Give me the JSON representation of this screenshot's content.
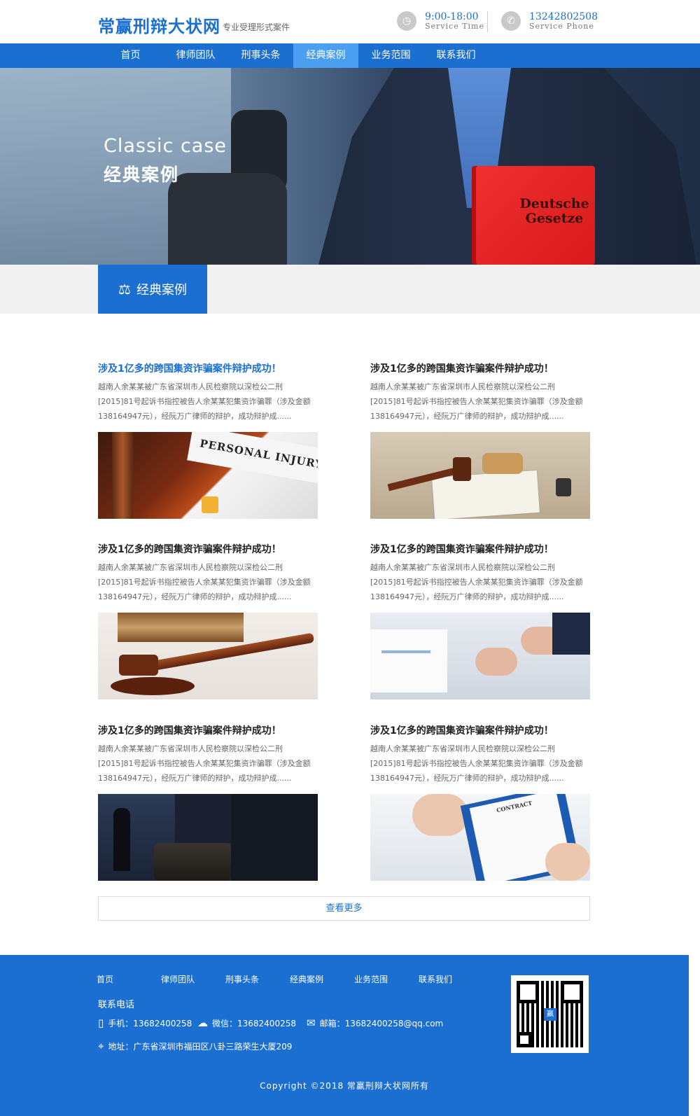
{
  "header": {
    "logo": "常赢刑辩大状网",
    "slogan": "专业受理形式案件",
    "time_value": "9:00-18:00",
    "time_label": "Service Time",
    "phone_value": "13242802508",
    "phone_label": "Service Phone"
  },
  "nav": {
    "items": [
      "首页",
      "律师团队",
      "刑事头条",
      "经典案例",
      "业务范围",
      "联系我们"
    ],
    "active_index": 3
  },
  "banner": {
    "title_en": "Classic case",
    "title_cn": "经典案例",
    "book_text": "Deutsche Gesetze"
  },
  "section": {
    "title": "经典案例"
  },
  "cases": [
    {
      "title": "涉及1亿多的跨国集资诈骗案件辩护成功！",
      "desc": "越南人余某某被广东省深圳市人民检察院以深检公二刑[2015]81号起诉书指控被告人余某某犯集资诈骗罪（涉及金额138164947元），经阮万广律师的辩护，成功辩护成......",
      "highlight": true,
      "image_text": "PERSONAL INJURY"
    },
    {
      "title": "涉及1亿多的跨国集资诈骗案件辩护成功！",
      "desc": "越南人余某某被广东省深圳市人民检察院以深检公二刑[2015]81号起诉书指控被告人余某某犯集资诈骗罪（涉及金额138164947元），经阮万广律师的辩护，成功辩护成......",
      "highlight": false
    },
    {
      "title": "涉及1亿多的跨国集资诈骗案件辩护成功！",
      "desc": "越南人余某某被广东省深圳市人民检察院以深检公二刑[2015]81号起诉书指控被告人余某某犯集资诈骗罪（涉及金额138164947元），经阮万广律师的辩护，成功辩护成......",
      "highlight": false
    },
    {
      "title": "涉及1亿多的跨国集资诈骗案件辩护成功！",
      "desc": "越南人余某某被广东省深圳市人民检察院以深检公二刑[2015]81号起诉书指控被告人余某某犯集资诈骗罪（涉及金额138164947元），经阮万广律师的辩护，成功辩护成......",
      "highlight": false
    },
    {
      "title": "涉及1亿多的跨国集资诈骗案件辩护成功！",
      "desc": "越南人余某某被广东省深圳市人民检察院以深检公二刑[2015]81号起诉书指控被告人余某某犯集资诈骗罪（涉及金额138164947元），经阮万广律师的辩护，成功辩护成......",
      "highlight": false
    },
    {
      "title": "涉及1亿多的跨国集资诈骗案件辩护成功！",
      "desc": "越南人余某某被广东省深圳市人民检察院以深检公二刑[2015]81号起诉书指控被告人余某某犯集资诈骗罪（涉及金额138164947元），经阮万广律师的辩护，成功辩护成......",
      "highlight": false,
      "image_text": "CONTRACT"
    }
  ],
  "more_label": "查看更多",
  "footer": {
    "nav": [
      "首页",
      "律师团队",
      "刑事头条",
      "经典案例",
      "业务范围",
      "联系我们"
    ],
    "contact_title": "联系电话",
    "mobile": "手机：13682400258",
    "wechat": "微信：13682400258",
    "email": "邮箱：13682400258@qq.com",
    "address": "地址：广东省深圳市福田区八卦三路荣生大厦209",
    "qr_mark": "赢",
    "copyright": "Copyright ©2018  常赢刑辩大状网所有"
  },
  "colors": {
    "brand_blue": "#1b6fd1",
    "nav_active": "#4a9ff0"
  }
}
